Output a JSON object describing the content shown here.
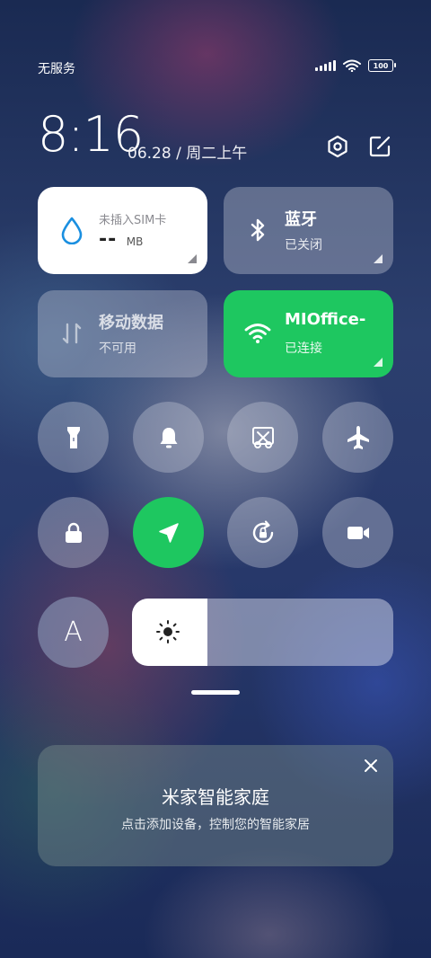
{
  "status": {
    "carrier": "无服务",
    "battery": "100"
  },
  "header": {
    "time": "8:16",
    "date": "06.28 / 周二上午"
  },
  "tiles": {
    "data_usage": {
      "title": "未插入SIM卡",
      "value": "--",
      "unit": "MB"
    },
    "bluetooth": {
      "title": "蓝牙",
      "status": "已关闭"
    },
    "mobile_data": {
      "title": "移动数据",
      "status": "不可用"
    },
    "wifi": {
      "title": "MIOffice-",
      "status": "已连接"
    }
  },
  "toggles": [
    {
      "icon": "flashlight-icon",
      "state": "off"
    },
    {
      "icon": "bell-icon",
      "state": "off"
    },
    {
      "icon": "screenshot-icon",
      "state": "off"
    },
    {
      "icon": "airplane-icon",
      "state": "off"
    },
    {
      "icon": "lock-icon",
      "state": "off"
    },
    {
      "icon": "location-icon",
      "state": "on"
    },
    {
      "icon": "rotation-lock-icon",
      "state": "off"
    },
    {
      "icon": "video-camera-icon",
      "state": "off"
    }
  ],
  "auto_brightness_label": "A",
  "brightness": {
    "level": 0.29
  },
  "colors": {
    "accent_green": "#1ec760",
    "tile_white": "#ffffff",
    "drop_blue": "#1a8fe0"
  },
  "smart_home": {
    "title": "米家智能家庭",
    "subtitle": "点击添加设备，控制您的智能家居"
  }
}
